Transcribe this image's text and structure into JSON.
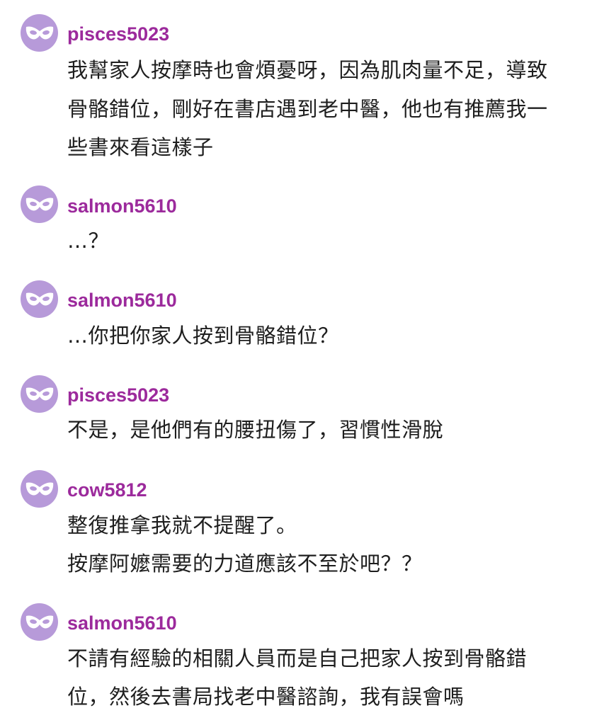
{
  "theme": {
    "avatar_color": "#b79ad9",
    "username_color": "#9c2a9c",
    "text_color": "#1e1e1e",
    "avatar_icon": "mask-icon"
  },
  "comments": [
    {
      "username": "pisces5023",
      "lines": [
        "我幫家人按摩時也會煩憂呀，因為肌肉量不足，導致",
        "骨骼錯位，剛好在書店遇到老中醫，他也有推薦我一",
        "些書來看這樣子"
      ]
    },
    {
      "username": "salmon5610",
      "lines": [
        "…？"
      ]
    },
    {
      "username": "salmon5610",
      "lines": [
        "…你把你家人按到骨骼錯位？"
      ]
    },
    {
      "username": "pisces5023",
      "lines": [
        "不是，是他們有的腰扭傷了，習慣性滑脫"
      ]
    },
    {
      "username": "cow5812",
      "lines": [
        "整復推拿我就不提醒了。",
        "按摩阿嬤需要的力道應該不至於吧？？"
      ]
    },
    {
      "username": "salmon5610",
      "lines": [
        "不請有經驗的相關人員而是自己把家人按到骨骼錯",
        "位，然後去書局找老中醫諮詢，我有誤會嗎"
      ]
    }
  ]
}
